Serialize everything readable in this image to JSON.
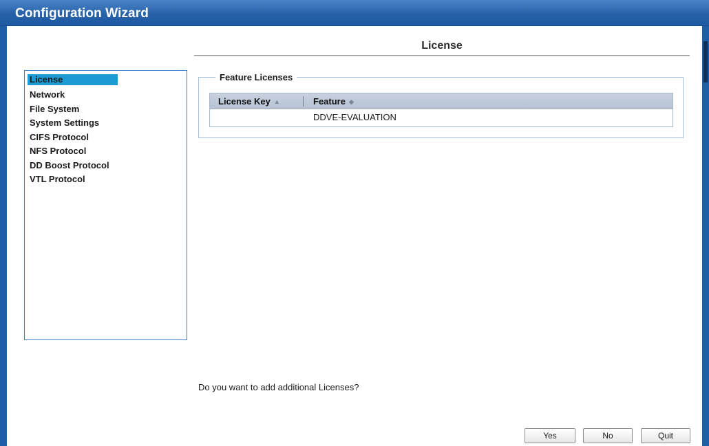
{
  "window": {
    "title": "Configuration Wizard"
  },
  "page": {
    "heading": "License"
  },
  "steps": [
    {
      "label": "License",
      "active": true
    },
    {
      "label": "Network",
      "active": false
    },
    {
      "label": "File System",
      "active": false
    },
    {
      "label": "System Settings",
      "active": false
    },
    {
      "label": "CIFS Protocol",
      "active": false
    },
    {
      "label": "NFS Protocol",
      "active": false
    },
    {
      "label": "DD Boost Protocol",
      "active": false
    },
    {
      "label": "VTL Protocol",
      "active": false
    }
  ],
  "feature_licenses": {
    "legend": "Feature Licenses",
    "columns": [
      {
        "label": "License Key",
        "sort_icon": "sort-ascending-icon",
        "sort_glyph": "▲"
      },
      {
        "label": "Feature",
        "sort_icon": "sort-neutral-icon",
        "sort_glyph": "◆"
      }
    ],
    "rows": [
      {
        "license_key": "",
        "feature": "DDVE-EVALUATION"
      }
    ]
  },
  "prompt": {
    "question": "Do you want to add additional Licenses?"
  },
  "buttons": {
    "yes": "Yes",
    "no": "No",
    "quit": "Quit"
  },
  "colors": {
    "titlebar": "#2762a9",
    "active_step": "#1b9ad4",
    "panel_border": "#3e7cc4"
  }
}
